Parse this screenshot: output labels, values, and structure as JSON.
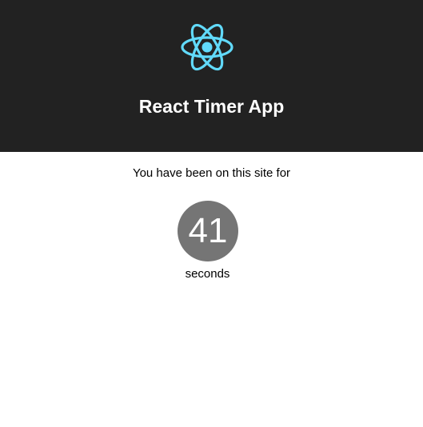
{
  "header": {
    "logo_icon": "react-atom-icon",
    "logo_color": "#61dafb",
    "background": "#222222",
    "title": "React Timer App"
  },
  "timer": {
    "intro_text": "You have been on this site for",
    "seconds_value": "41",
    "unit_label": "seconds",
    "circle_color": "#757575"
  }
}
